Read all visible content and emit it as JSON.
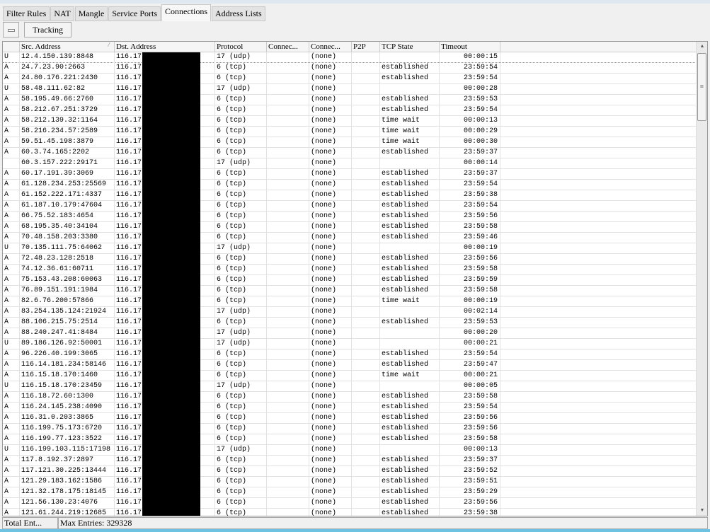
{
  "tabs": [
    {
      "label": "Filter Rules"
    },
    {
      "label": "NAT"
    },
    {
      "label": "Mangle"
    },
    {
      "label": "Service Ports"
    },
    {
      "label": "Connections",
      "active": true
    },
    {
      "label": "Address Lists"
    }
  ],
  "toolbar": {
    "remove_icon": "minus-icon",
    "tracking_label": "Tracking"
  },
  "columns": [
    "",
    "Src. Address",
    "Dst. Address",
    "Protocol",
    "Connec...",
    "Connec...",
    "P2P",
    "TCP State",
    "Timeout"
  ],
  "dst_prefix": "116.17.",
  "conn_mark": "(none)",
  "rows": [
    [
      "U",
      "12.4.150.139:8848",
      "17 (udp)",
      "",
      "00:00:15"
    ],
    [
      "A",
      "24.7.23.90:2663",
      "6 (tcp)",
      "established",
      "23:59:54"
    ],
    [
      "A",
      "24.80.176.221:2430",
      "6 (tcp)",
      "established",
      "23:59:54"
    ],
    [
      "U",
      "58.48.111.62:82",
      "17 (udp)",
      "",
      "00:00:28"
    ],
    [
      "A",
      "58.195.49.66:2760",
      "6 (tcp)",
      "established",
      "23:59:53"
    ],
    [
      "A",
      "58.212.67.251:3729",
      "6 (tcp)",
      "established",
      "23:59:54"
    ],
    [
      "A",
      "58.212.139.32:1164",
      "6 (tcp)",
      "time wait",
      "00:00:13"
    ],
    [
      "A",
      "58.216.234.57:2589",
      "6 (tcp)",
      "time wait",
      "00:00:29"
    ],
    [
      "A",
      "59.51.45.198:3879",
      "6 (tcp)",
      "time wait",
      "00:00:30"
    ],
    [
      "A",
      "60.3.74.165:2202",
      "6 (tcp)",
      "established",
      "23:59:37"
    ],
    [
      "",
      "60.3.157.222:29171",
      "17 (udp)",
      "",
      "00:00:14"
    ],
    [
      "A",
      "60.17.191.39:3069",
      "6 (tcp)",
      "established",
      "23:59:37"
    ],
    [
      "A",
      "61.128.234.253:25569",
      "6 (tcp)",
      "established",
      "23:59:54"
    ],
    [
      "A",
      "61.152.222.171:4337",
      "6 (tcp)",
      "established",
      "23:59:38"
    ],
    [
      "A",
      "61.187.10.179:47604",
      "6 (tcp)",
      "established",
      "23:59:54"
    ],
    [
      "A",
      "66.75.52.183:4654",
      "6 (tcp)",
      "established",
      "23:59:56"
    ],
    [
      "A",
      "68.195.35.40:34104",
      "6 (tcp)",
      "established",
      "23:59:58"
    ],
    [
      "A",
      "70.48.158.203:3380",
      "6 (tcp)",
      "established",
      "23:59:46"
    ],
    [
      "U",
      "70.135.111.75:64062",
      "17 (udp)",
      "",
      "00:00:19"
    ],
    [
      "A",
      "72.48.23.128:2518",
      "6 (tcp)",
      "established",
      "23:59:56"
    ],
    [
      "A",
      "74.12.36.61:60711",
      "6 (tcp)",
      "established",
      "23:59:58"
    ],
    [
      "A",
      "75.153.43.208:60063",
      "6 (tcp)",
      "established",
      "23:59:59"
    ],
    [
      "A",
      "76.89.151.191:1984",
      "6 (tcp)",
      "established",
      "23:59:58"
    ],
    [
      "A",
      "82.6.76.200:57866",
      "6 (tcp)",
      "time wait",
      "00:00:19"
    ],
    [
      "A",
      "83.254.135.124:21924",
      "17 (udp)",
      "",
      "00:02:14"
    ],
    [
      "A",
      "88.106.215.75:2514",
      "6 (tcp)",
      "established",
      "23:59:53"
    ],
    [
      "A",
      "88.240.247.41:8484",
      "17 (udp)",
      "",
      "00:00:20"
    ],
    [
      "U",
      "89.186.126.92:50001",
      "17 (udp)",
      "",
      "00:00:21"
    ],
    [
      "A",
      "96.226.40.199:3065",
      "6 (tcp)",
      "established",
      "23:59:54"
    ],
    [
      "A",
      "116.14.181.234:58146",
      "6 (tcp)",
      "established",
      "23:59:47"
    ],
    [
      "A",
      "116.15.18.170:1460",
      "6 (tcp)",
      "time wait",
      "00:00:21"
    ],
    [
      "U",
      "116.15.18.170:23459",
      "17 (udp)",
      "",
      "00:00:05"
    ],
    [
      "A",
      "116.18.72.60:1300",
      "6 (tcp)",
      "established",
      "23:59:58"
    ],
    [
      "A",
      "116.24.145.238:4090",
      "6 (tcp)",
      "established",
      "23:59:54"
    ],
    [
      "A",
      "116.31.0.203:3865",
      "6 (tcp)",
      "established",
      "23:59:56"
    ],
    [
      "A",
      "116.199.75.173:6720",
      "6 (tcp)",
      "established",
      "23:59:56"
    ],
    [
      "A",
      "116.199.77.123:3522",
      "6 (tcp)",
      "established",
      "23:59:58"
    ],
    [
      "U",
      "116.199.103.115:17198",
      "17 (udp)",
      "",
      "00:00:13"
    ],
    [
      "A",
      "117.8.192.37:2897",
      "6 (tcp)",
      "established",
      "23:59:37"
    ],
    [
      "A",
      "117.121.30.225:13444",
      "6 (tcp)",
      "established",
      "23:59:52"
    ],
    [
      "A",
      "121.29.183.162:1586",
      "6 (tcp)",
      "established",
      "23:59:51"
    ],
    [
      "A",
      "121.32.178.175:18145",
      "6 (tcp)",
      "established",
      "23:59:29"
    ],
    [
      "A",
      "121.56.130.23:4076",
      "6 (tcp)",
      "established",
      "23:59:56"
    ],
    [
      "A",
      "121.61.244.219:12685",
      "6 (tcp)",
      "established",
      "23:59:38"
    ]
  ],
  "status": {
    "total_label": "Total Ent...",
    "max_entries": "Max Entries: 329328"
  },
  "colors": {
    "redaction": "#000000",
    "accent_bar": "#6cc2e0"
  }
}
